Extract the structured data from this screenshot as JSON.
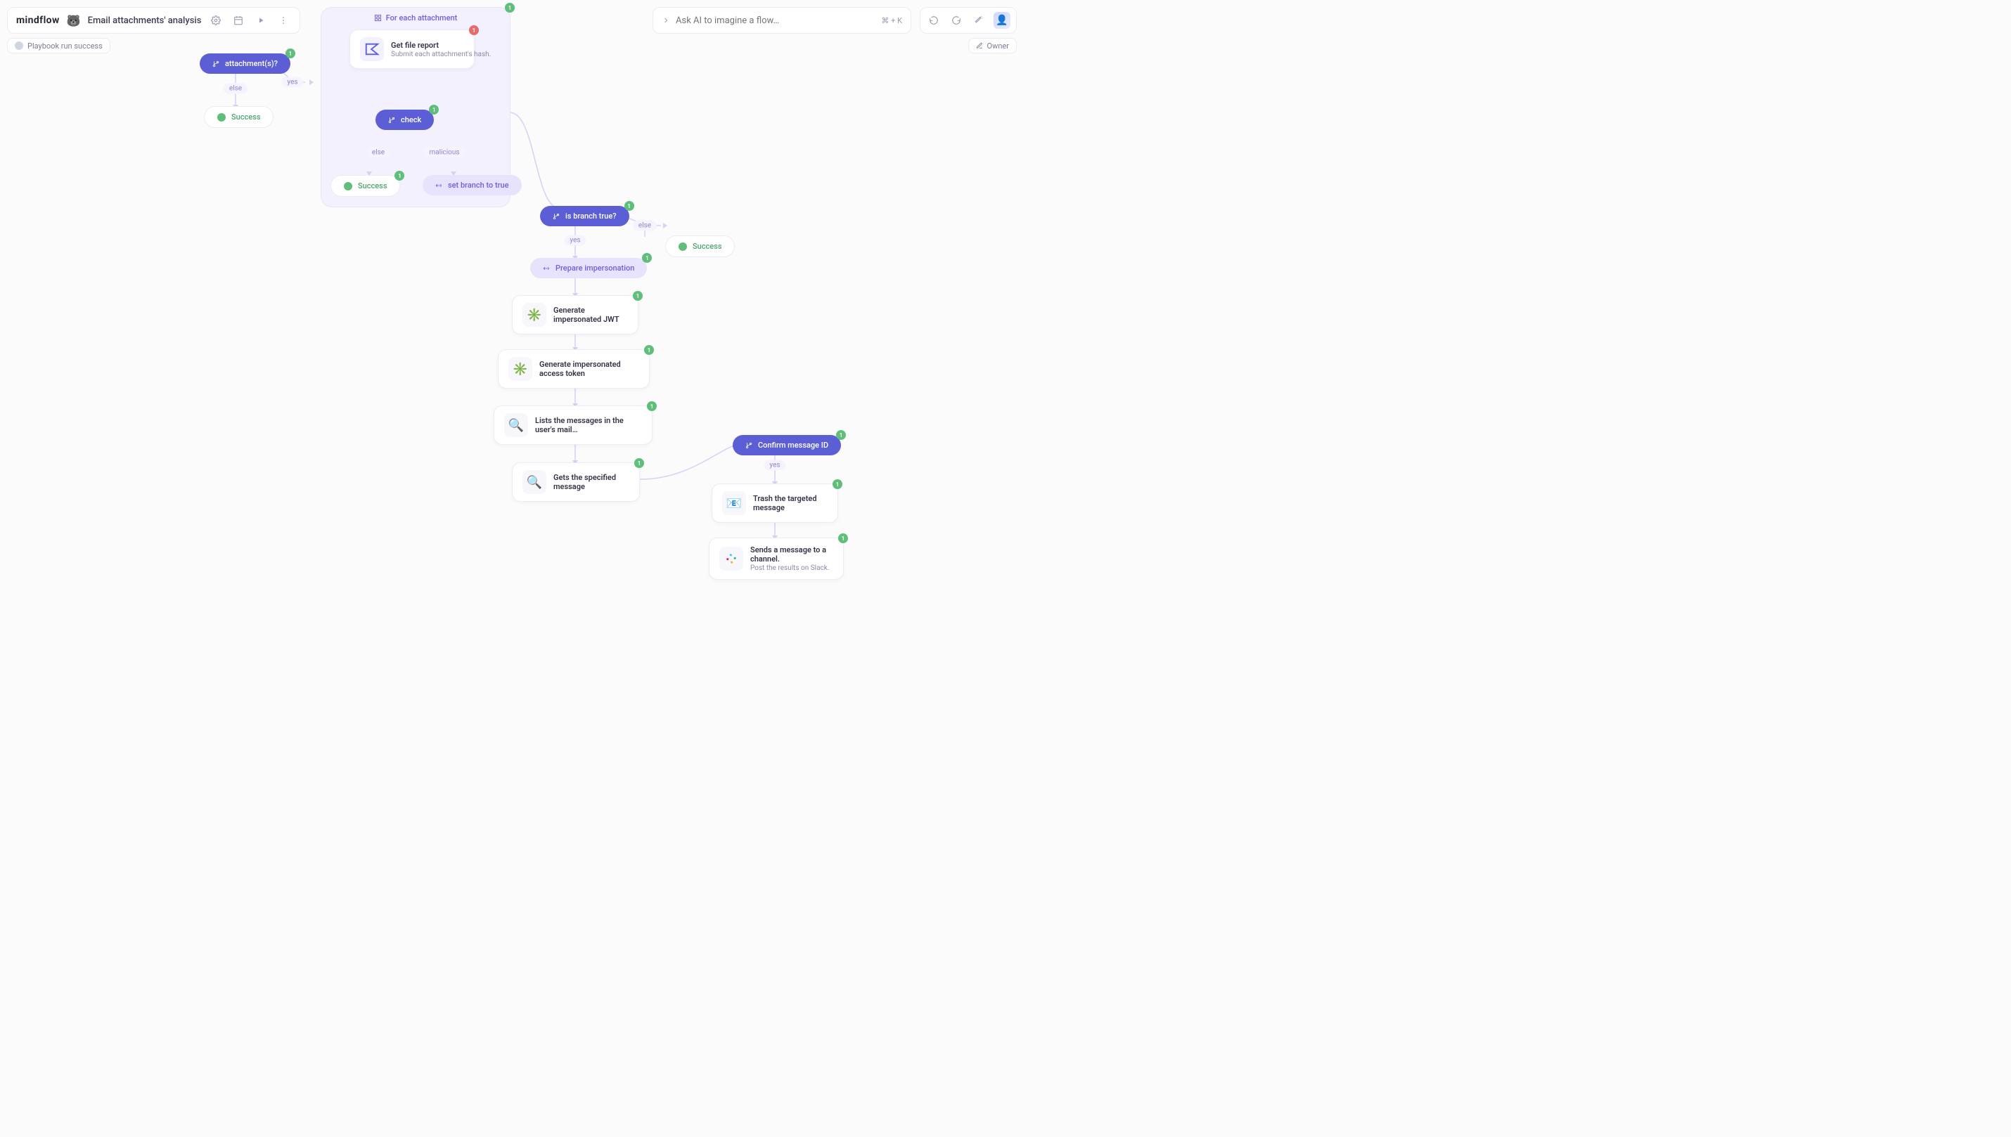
{
  "app": {
    "brand": "mindflow",
    "title": "Email attachments' analysis",
    "ai_placeholder": "Ask AI to imagine a flow…",
    "ai_shortcut": "⌘ + K",
    "status": "Playbook run success",
    "owner_label": "Owner"
  },
  "loop": {
    "title": "For each attachment"
  },
  "labels": {
    "else": "else",
    "yes": "yes",
    "malicious": "malicious",
    "success": "Success"
  },
  "nodes": {
    "attachments_q": "attachment(s)?",
    "get_file_report": {
      "title": "Get file report",
      "sub": "Submit each attachment's hash."
    },
    "check": "check",
    "set_branch": "set branch to true",
    "is_branch_true": "is branch true?",
    "prepare_impersonation": "Prepare impersonation",
    "gen_jwt": "Generate impersonated JWT",
    "gen_token": "Generate impersonated access token",
    "list_msgs": "Lists the messages in the user's mail…",
    "get_msg": "Gets the specified message",
    "confirm_id": "Confirm message ID",
    "trash_msg": "Trash the targeted message",
    "slack": {
      "title": "Sends a message to a channel.",
      "sub": "Post the results on Slack."
    }
  }
}
